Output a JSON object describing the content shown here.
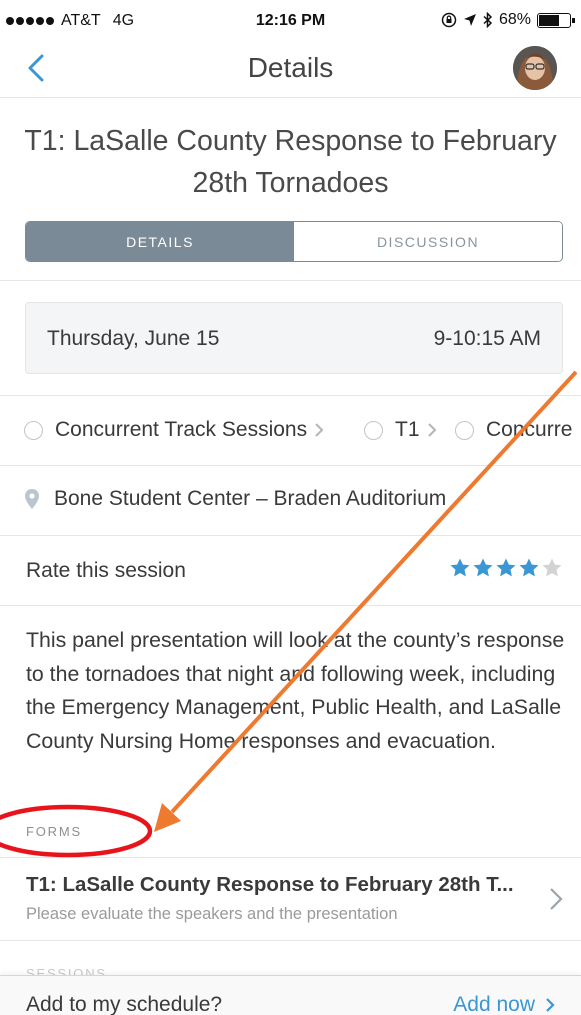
{
  "status_bar": {
    "carrier": "AT&T",
    "network": "4G",
    "time": "12:16 PM",
    "battery": "68%",
    "battery_level": 0.68
  },
  "nav": {
    "title": "Details"
  },
  "session": {
    "title": "T1: LaSalle County Response to February 28th Tornadoes"
  },
  "tabs": [
    {
      "label": "DETAILS",
      "active": true
    },
    {
      "label": "DISCUSSION",
      "active": false
    }
  ],
  "schedule": {
    "date": "Thursday, June 15",
    "time": "9-10:15 AM"
  },
  "tracks": [
    {
      "label": "Concurrent Track Sessions"
    },
    {
      "label": "T1"
    },
    {
      "label": "Concurre"
    }
  ],
  "location": "Bone Student Center – Braden Auditorium",
  "rating": {
    "label": "Rate this session",
    "value": 4,
    "max": 5,
    "filled_color": "#3a97d4",
    "empty_color": "#d3d3d3"
  },
  "description": "This panel presentation will look at the county’s response to the tornadoes that night and following week, including the Emergency Management, Public Health, and LaSalle County Nursing Home responses and evacuation.",
  "forms": {
    "header": "FORMS",
    "items": [
      {
        "title": "T1: LaSalle County Response to February 28th T...",
        "subtitle": "Please evaluate the speakers and the presentation"
      }
    ]
  },
  "sessions_header": "SESSIONS",
  "bottom_bar": {
    "question": "Add to my schedule?",
    "action": "Add now"
  },
  "colors": {
    "accent": "#3a97d4",
    "tab_active": "#7a8a96",
    "annotation_ellipse": "#e8141c",
    "annotation_arrow": "#ee7a2f"
  }
}
